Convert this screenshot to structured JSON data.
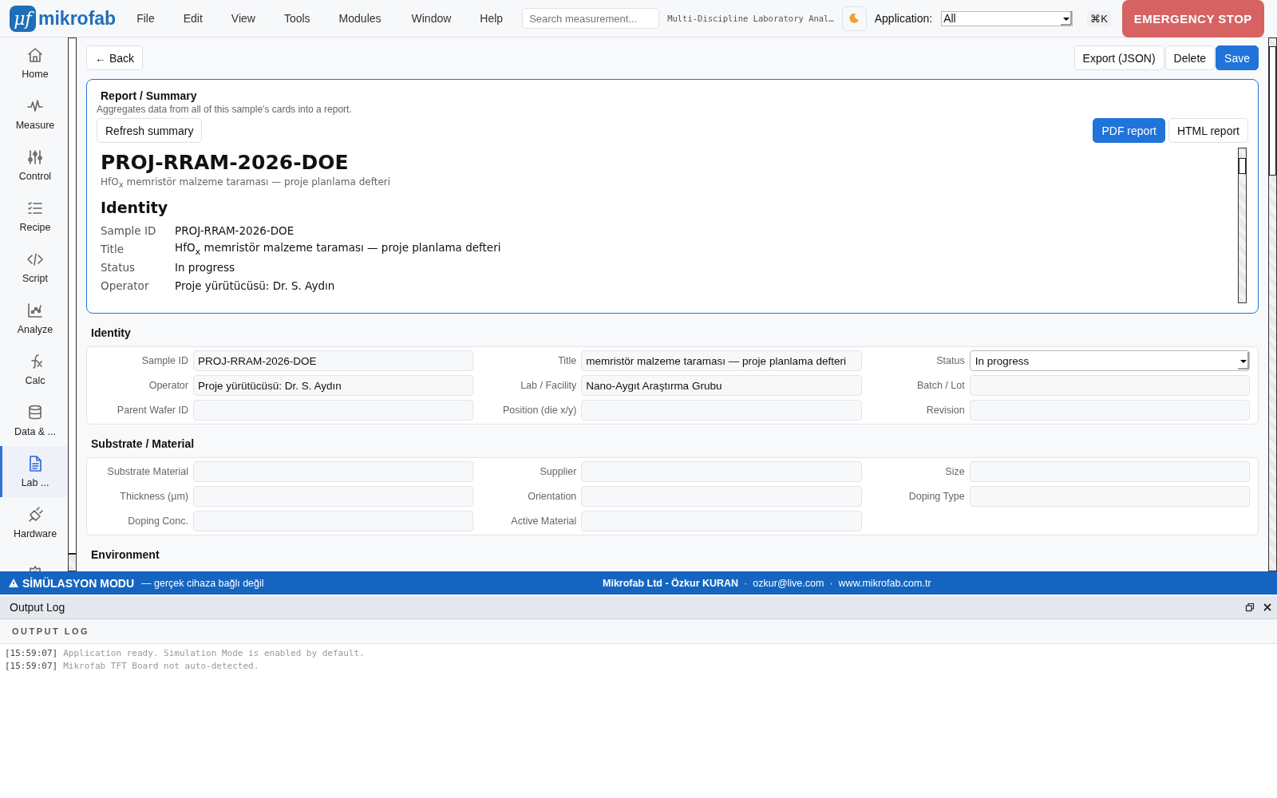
{
  "app": {
    "logo_mark": "μf",
    "logo_text": "mikrofab"
  },
  "menu": [
    "File",
    "Edit",
    "View",
    "Tools",
    "Modules",
    "Window",
    "Help"
  ],
  "search": {
    "placeholder": "Search measurement..."
  },
  "document_title": "Multi-Discipline Laboratory Anal…",
  "application_filter": {
    "label": "Application:",
    "value": "All"
  },
  "shortcut": "⌘K",
  "emergency_button": "EMERGENCY STOP",
  "sidebar": {
    "items": [
      {
        "label": "Home",
        "selected": false
      },
      {
        "label": "Measure",
        "selected": false
      },
      {
        "label": "Control",
        "selected": false
      },
      {
        "label": "Recipe",
        "selected": false
      },
      {
        "label": "Script",
        "selected": false
      },
      {
        "label": "Analyze",
        "selected": false
      },
      {
        "label": "Calc",
        "selected": false
      },
      {
        "label": "Data & ...",
        "selected": false
      },
      {
        "label": "Lab ...",
        "selected": true
      },
      {
        "label": "Hardware",
        "selected": false
      },
      {
        "selected": false
      }
    ]
  },
  "toolbar": {
    "back": "← Back",
    "buttons": [
      {
        "label": "Export (JSON)",
        "kind": "default"
      },
      {
        "label": "Delete",
        "kind": "default"
      },
      {
        "label": "Save",
        "kind": "primary"
      }
    ]
  },
  "report": {
    "title": "Report / Summary",
    "description": "Aggregates data from all of this sample's cards into a report.",
    "refresh_button": "Refresh summary",
    "buttons": [
      {
        "label": "PDF report",
        "kind": "primary"
      },
      {
        "label": "HTML report",
        "kind": "default"
      }
    ],
    "document": {
      "heading": "PROJ-RRAM-2026-DOE",
      "subtitle": "HfO$_{x}$ memristör malzeme taraması — proje planlama defteri",
      "section": "Identity",
      "rows": [
        {
          "label": "Sample ID",
          "value": "PROJ-RRAM-2026-DOE"
        },
        {
          "label": "Title",
          "value": "HfO$_{x}$ memristör malzeme taraması — proje planlama defteri"
        },
        {
          "label": "Status",
          "value": "In progress"
        },
        {
          "label": "Operator",
          "value": "Proje yürütücüsü: Dr. S. Aydın"
        }
      ]
    }
  },
  "sections": [
    {
      "title": "Identity",
      "fields": [
        {
          "label": "Sample ID",
          "kind": "text",
          "value": "PROJ-RRAM-2026-DOE"
        },
        {
          "label": "Title",
          "kind": "text",
          "value": "memristör malzeme taraması — proje planlama defteri"
        },
        {
          "label": "Status",
          "kind": "select",
          "value": "In progress"
        },
        {
          "label": "Operator",
          "kind": "text",
          "value": "Proje yürütücüsü: Dr. S. Aydın"
        },
        {
          "label": "Lab / Facility",
          "kind": "text",
          "value": "Nano-Aygıt Araştırma Grubu"
        },
        {
          "label": "Batch / Lot",
          "kind": "text"
        },
        {
          "label": "Parent Wafer ID",
          "kind": "text"
        },
        {
          "label": "Position (die x/y)",
          "kind": "text"
        },
        {
          "label": "Revision",
          "kind": "text"
        }
      ]
    },
    {
      "title": "Substrate / Material",
      "fields": [
        {
          "label": "Substrate Material",
          "kind": "text"
        },
        {
          "label": "Supplier",
          "kind": "text"
        },
        {
          "label": "Size",
          "kind": "text"
        },
        {
          "label": "Thickness (µm)",
          "kind": "text"
        },
        {
          "label": "Orientation",
          "kind": "text"
        },
        {
          "label": "Doping Type",
          "kind": "text"
        },
        {
          "label": "Doping Conc.",
          "kind": "text"
        },
        {
          "label": "Active Material",
          "kind": "text"
        }
      ]
    },
    {
      "title": "Environment"
    }
  ],
  "status_bar": {
    "mode": "SİMÜLASYON MODU",
    "mode_note": "— gerçek cihaza bağlı değil",
    "company": "Mikrofab Ltd - Özkur KURAN",
    "separator_1": "·",
    "email": "ozkur@live.com",
    "separator_2": "·",
    "website": "www.mikrofab.com.tr"
  },
  "output_log": {
    "title": "Output Log",
    "heading": "OUTPUT LOG",
    "lines": [
      {
        "time": "[15:59:07]",
        "message": "Application ready. Simulation Mode is enabled by default."
      },
      {
        "time": "[15:59:07]",
        "message": "Mikrofab TFT Board not auto-detected."
      }
    ]
  }
}
